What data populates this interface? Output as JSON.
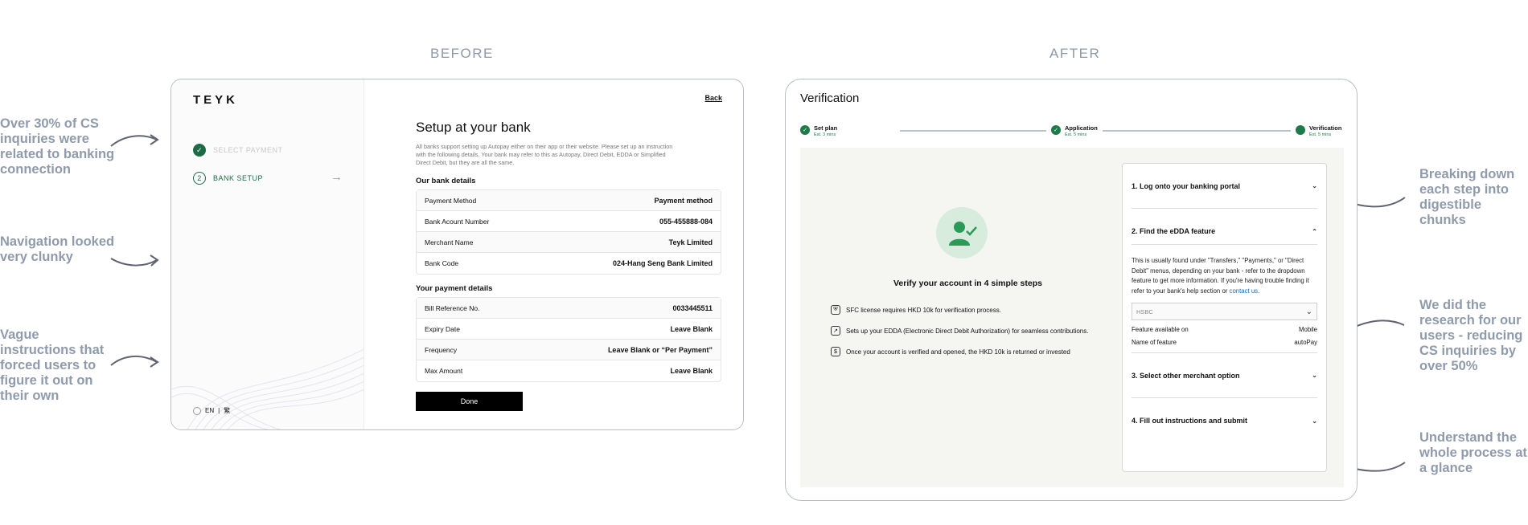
{
  "headings": {
    "before": "BEFORE",
    "after": "AFTER"
  },
  "left_notes": [
    "Over 30% of CS inquiries were related to banking connection",
    "Navigation looked very clunky",
    "Vague instructions that forced users to figure it out on their own"
  ],
  "right_notes": [
    "Breaking down each step into digestible chunks",
    "We did the research for our users - reducing CS inquiries by over 50%",
    "Understand the whole process at a glance"
  ],
  "before": {
    "logo": "TEYK",
    "back_label": "Back",
    "steps": [
      {
        "label": "SELECT PAYMENT",
        "marker": "✓"
      },
      {
        "label": "BANK SETUP",
        "marker": "2"
      }
    ],
    "title": "Setup at your bank",
    "description": "All banks support setting up Autopay either on their app or their website. Please set up an instruction with the following details. Your bank may refer to this as Autopay, Direct Debit, EDDA or Simplified Direct Debit, but they are all the same.",
    "bank_section_title": "Our bank details",
    "bank_rows": [
      {
        "label": "Payment Method",
        "value": "Payment method"
      },
      {
        "label": "Bank Acount Number",
        "value": "055-455888-084"
      },
      {
        "label": "Merchant Name",
        "value": "Teyk Limited"
      },
      {
        "label": "Bank Code",
        "value": "024-Hang Seng Bank Limited"
      }
    ],
    "payment_section_title": "Your payment details",
    "payment_rows": [
      {
        "label": "Bill Reference No.",
        "value": "0033445511"
      },
      {
        "label": "Expiry Date",
        "value": "Leave Blank"
      },
      {
        "label": "Frequency",
        "value": "Leave Blank or “Per Payment”"
      },
      {
        "label": "Max Amount",
        "value": "Leave Blank"
      }
    ],
    "done_label": "Done",
    "lang_en": "EN",
    "lang_sep": "|",
    "lang_zh": "繁"
  },
  "after": {
    "title": "Verification",
    "steps": [
      {
        "label": "Set plan",
        "sub": "Est. 3 mins"
      },
      {
        "label": "Application",
        "sub": "Est. 5 mins"
      },
      {
        "label": "Verification",
        "sub": "Est. 5 mins"
      }
    ],
    "verify_title": "Verify your account in 4 simple steps",
    "verify_items": [
      "SFC license requires HKD 10k for verification process.",
      "Sets up your EDDA (Electronic Direct Debit Authorization) for seamless contributions.",
      "Once your account is verified and opened, the HKD 10k is returned or invested"
    ],
    "accordion": {
      "item1": "1. Log onto your banking portal",
      "item2": "2. Find the eDDA feature",
      "item2_body": "This is usually found under \"Transfers,\" \"Payments,\" or \"Direct Debit\" menus, depending on your bank - refer to the dropdown feature to get more information. If you're having trouble finding it refer to your bank's help section or",
      "item2_link": "contact us",
      "item2_period": ".",
      "bank_select": "HSBC",
      "feature_label": "Feature available on",
      "feature_value": "Mobile",
      "name_label": "Name of feature",
      "name_value": "autoPay",
      "item3": "3. Select other merchant option",
      "item4": "4. Fill out instructions and submit"
    }
  },
  "colors": {
    "accent_green": "#1e7a48",
    "note_gray": "#8f9bab",
    "panel_bg": "#f5f6f1"
  }
}
